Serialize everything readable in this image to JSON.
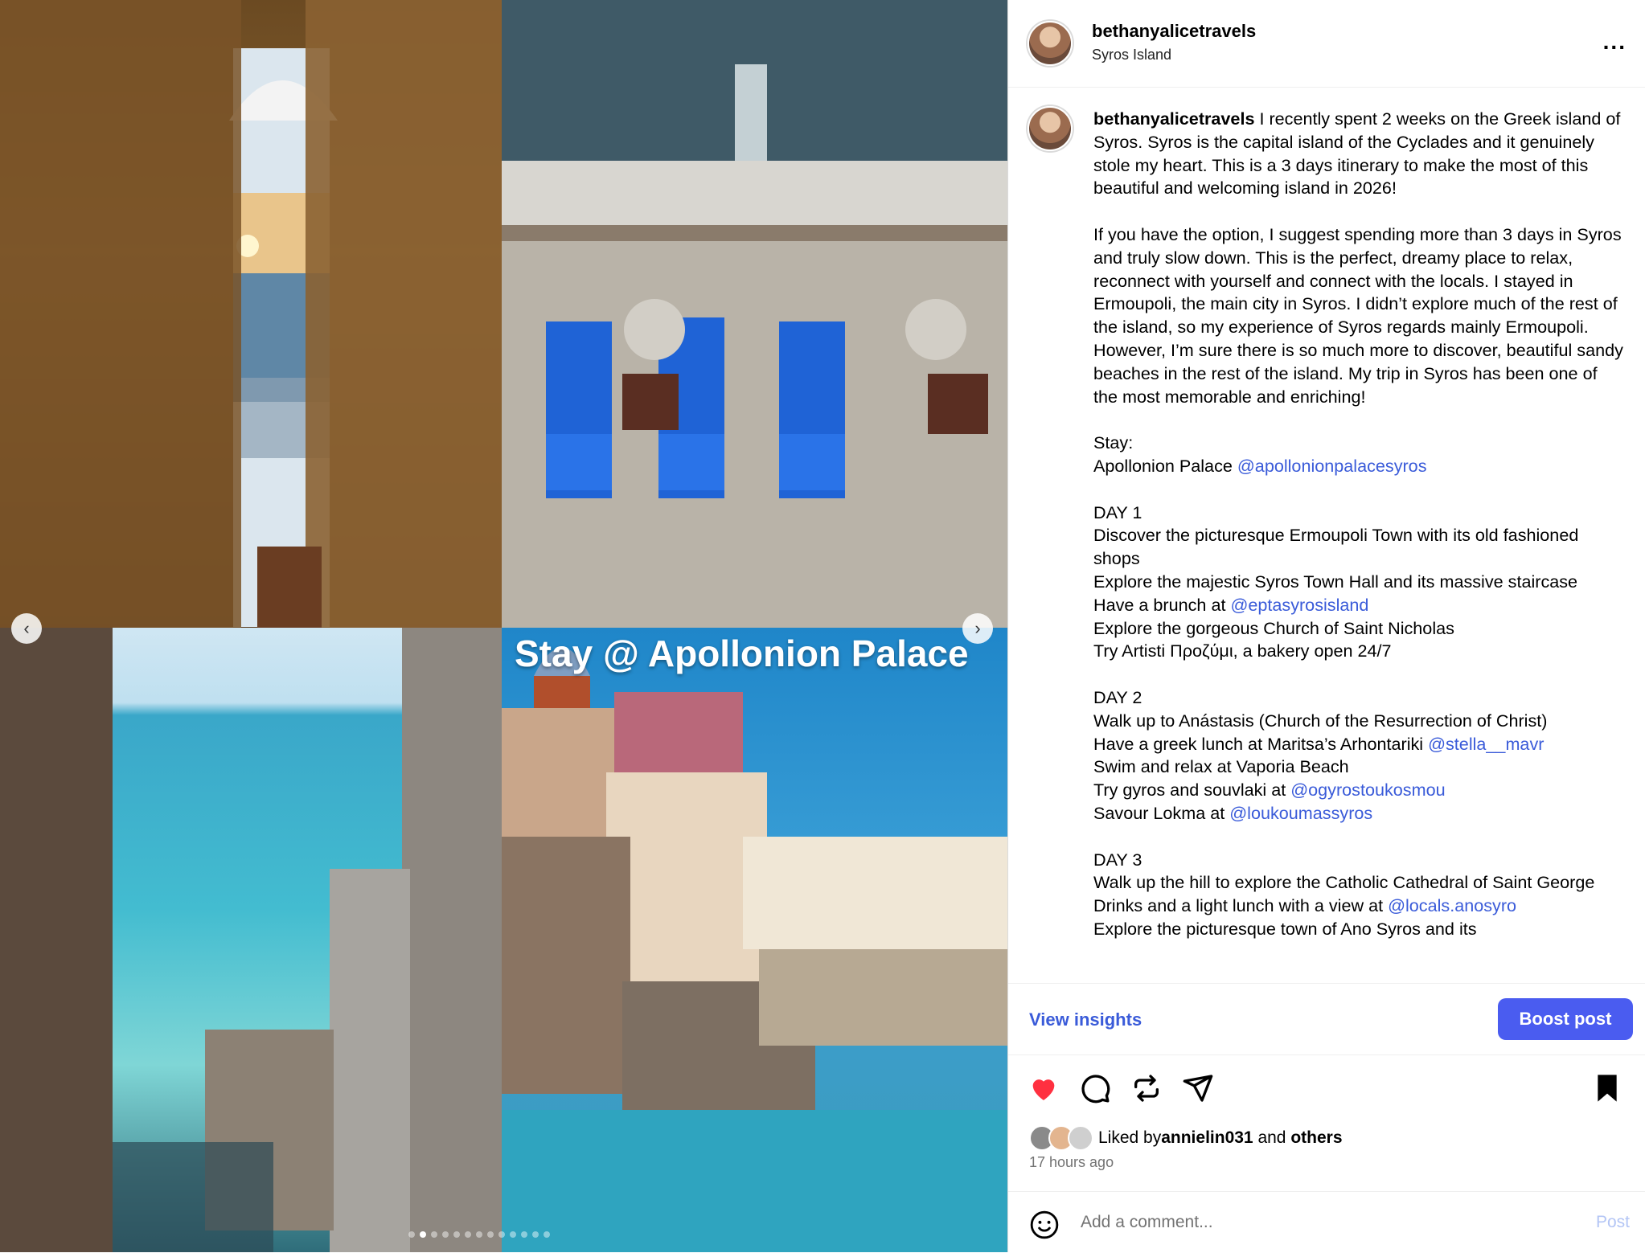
{
  "media": {
    "overlay_title": "Stay @ Apollonion Palace",
    "prev_arrow": "‹",
    "next_arrow": "›",
    "carousel_total": 13,
    "carousel_active": 1
  },
  "header": {
    "username": "bethanyalicetravels",
    "location": "Syros Island",
    "more_icon": "more-icon",
    "more_label": "..."
  },
  "caption": {
    "username": "bethanyalicetravels",
    "intro": " I recently spent 2 weeks on the Greek island of Syros. Syros is the capital island of the Cyclades and it genuinely stole my heart. This is a 3 days itinerary to make the most of this beautiful and welcoming island in 2026!",
    "para2": "If you have the option, I suggest spending more than 3 days in Syros and truly slow down. This is the perfect, dreamy place to relax, reconnect with yourself and connect with the locals. I stayed in Ermoupoli, the main city in Syros. I didn’t explore much of the rest of the island, so my experience of Syros regards mainly Ermoupoli. However, I’m sure there is so much more to discover, beautiful sandy beaches in the rest of the island. My trip in Syros has been one of the most memorable and enriching!",
    "stay_label": "Stay:",
    "stay_text": "Apollonion Palace ",
    "stay_link": "@apollonionpalacesyros",
    "day1": "DAY 1",
    "d1_l1": "Discover the picturesque Ermoupoli Town with its old fashioned shops",
    "d1_l2": "Explore the majestic Syros Town Hall and its massive staircase",
    "d1_l3": "Have a brunch at ",
    "d1_l3_link": "@eptasyrosisland",
    "d1_l4": "Explore the gorgeous Church of Saint Nicholas",
    "d1_l5": "Try Artisti Προζύμι, a bakery open 24/7",
    "day2": "DAY 2",
    "d2_l1": "Walk up to Anástasis (Church of the Resurrection of Christ)",
    "d2_l2": "Have a greek lunch at Maritsa’s Arhontariki ",
    "d2_l2_link": "@stella__mavr",
    "d2_l3": "Swim and relax at Vaporia Beach",
    "d2_l4": "Try gyros and souvlaki at ",
    "d2_l4_link": "@ogyrostoukosmou",
    "d2_l5": "Savour Lokma at ",
    "d2_l5_link": "@loukoumassyros",
    "day3": "DAY 3",
    "d3_l1": "Walk up the hill to explore the Catholic Cathedral of Saint George",
    "d3_l2": "Drinks and a light lunch with a view at ",
    "d3_l2_link": "@locals.anosyro",
    "d3_l3": "Explore the picturesque town of Ano Syros and its"
  },
  "actions": {
    "view_insights": "View insights",
    "boost_post": "Boost post"
  },
  "likes": {
    "prefix": "Liked by ",
    "user": "annielin031",
    "mid": " and ",
    "others": "others"
  },
  "time": "17 hours ago",
  "comment": {
    "placeholder": "Add a comment...",
    "post": "Post"
  },
  "colors": {
    "link": "#3a5bd9",
    "boost": "#4a5cf0",
    "heart": "#ff3040"
  }
}
